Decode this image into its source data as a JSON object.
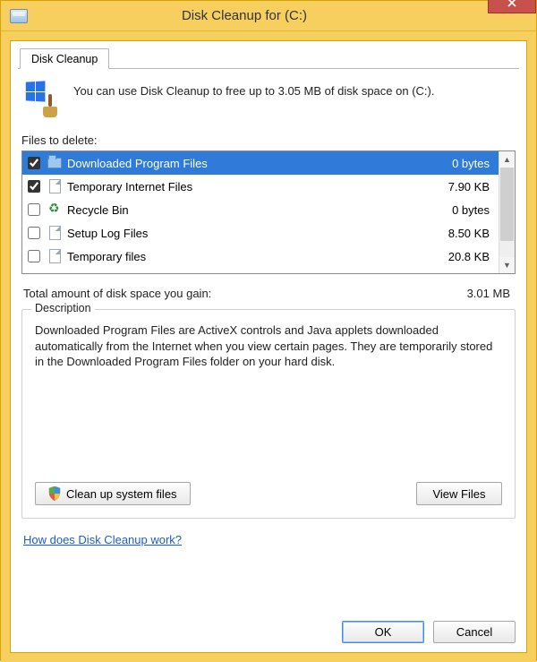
{
  "window": {
    "title": "Disk Cleanup for  (C:)"
  },
  "tab": {
    "label": "Disk Cleanup"
  },
  "intro": {
    "text": "You can use Disk Cleanup to free up to 3.05 MB of disk space on  (C:)."
  },
  "files_label": "Files to delete:",
  "items": [
    {
      "checked": true,
      "icon": "folder-blue",
      "name": "Downloaded Program Files",
      "size": "0 bytes",
      "selected": true
    },
    {
      "checked": true,
      "icon": "page",
      "name": "Temporary Internet Files",
      "size": "7.90 KB",
      "selected": false
    },
    {
      "checked": false,
      "icon": "recycle",
      "name": "Recycle Bin",
      "size": "0 bytes",
      "selected": false
    },
    {
      "checked": false,
      "icon": "page",
      "name": "Setup Log Files",
      "size": "8.50 KB",
      "selected": false
    },
    {
      "checked": false,
      "icon": "page",
      "name": "Temporary files",
      "size": "20.8 KB",
      "selected": false
    }
  ],
  "total": {
    "label": "Total amount of disk space you gain:",
    "value": "3.01 MB"
  },
  "description": {
    "legend": "Description",
    "text": "Downloaded Program Files are ActiveX controls and Java applets downloaded automatically from the Internet when you view certain pages. They are temporarily stored in the Downloaded Program Files folder on your hard disk."
  },
  "buttons": {
    "clean_system": "Clean up system files",
    "view_files": "View Files",
    "ok": "OK",
    "cancel": "Cancel"
  },
  "help_link": "How does Disk Cleanup work?"
}
